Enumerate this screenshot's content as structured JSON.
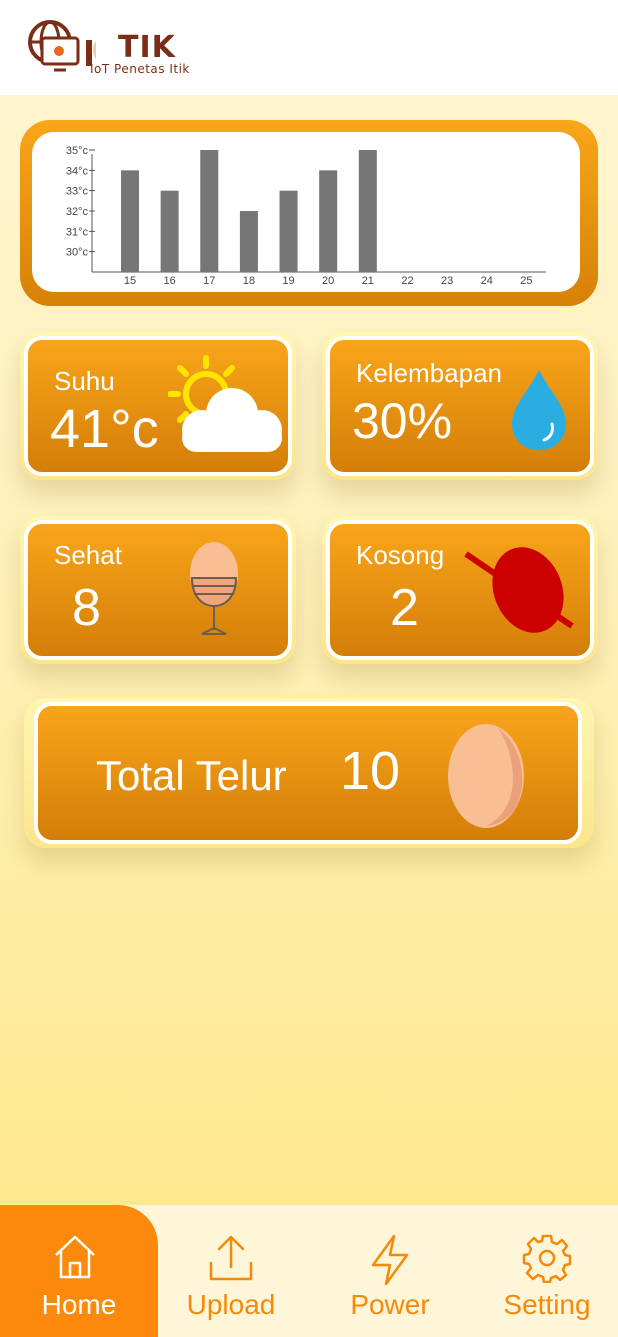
{
  "header": {
    "brand": "TIK",
    "subtitle": "IoT Penetas Itik"
  },
  "chart_data": {
    "type": "bar",
    "categories": [
      "15",
      "16",
      "17",
      "18",
      "19",
      "20",
      "21",
      "22",
      "23",
      "24",
      "25"
    ],
    "values": [
      34,
      33,
      35,
      32,
      33,
      34,
      35,
      null,
      null,
      null,
      null
    ],
    "y_ticks": [
      "30°c",
      "31°c",
      "32°c",
      "33°c",
      "34°c",
      "35°c"
    ],
    "ylim": [
      29,
      35
    ],
    "colors": {
      "bar": "#767676"
    }
  },
  "cards": {
    "suhu": {
      "label": "Suhu",
      "value": "41°c",
      "icon": "sun-cloud-icon"
    },
    "kelembapan": {
      "label": "Kelembapan",
      "value": "30%",
      "icon": "water-drop-icon"
    },
    "sehat": {
      "label": "Sehat",
      "value": "8",
      "icon": "egg-cup-icon"
    },
    "kosong": {
      "label": "Kosong",
      "value": "2",
      "icon": "crossed-egg-icon"
    },
    "total": {
      "label": "Total Telur",
      "value": "10",
      "icon": "egg-icon"
    }
  },
  "nav": {
    "items": [
      {
        "label": "Home",
        "icon": "home-icon",
        "active": true
      },
      {
        "label": "Upload",
        "icon": "upload-icon",
        "active": false
      },
      {
        "label": "Power",
        "icon": "lightning-icon",
        "active": false
      },
      {
        "label": "Setting",
        "icon": "gear-icon",
        "active": false
      }
    ]
  },
  "colors": {
    "accent": "#f9a51a",
    "accent_dark": "#d37e08",
    "nav_active": "#fb8a0c",
    "brand": "#7b2e17"
  }
}
